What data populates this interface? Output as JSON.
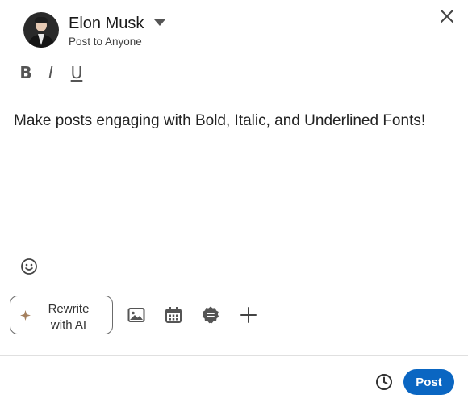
{
  "author": {
    "name": "Elon Musk",
    "audience": "Post to Anyone"
  },
  "formatting": {
    "bold_label": "B",
    "italic_label": "I",
    "underline_label": "U"
  },
  "composer": {
    "text": "Make posts engaging with Bold, Italic, and Underlined Fonts!"
  },
  "toolbar": {
    "rewrite_line1": "Rewrite",
    "rewrite_line2": "with AI",
    "icons": [
      "emoji-icon",
      "sparkle-icon",
      "image-icon",
      "calendar-icon",
      "badge-icon",
      "plus-icon"
    ]
  },
  "footer": {
    "post_label": "Post"
  },
  "colors": {
    "primary": "#0a66c2",
    "text": "#1f1f1f",
    "muted": "#555555",
    "divider": "#e0e0e0",
    "sparkle": "#a5805e"
  }
}
